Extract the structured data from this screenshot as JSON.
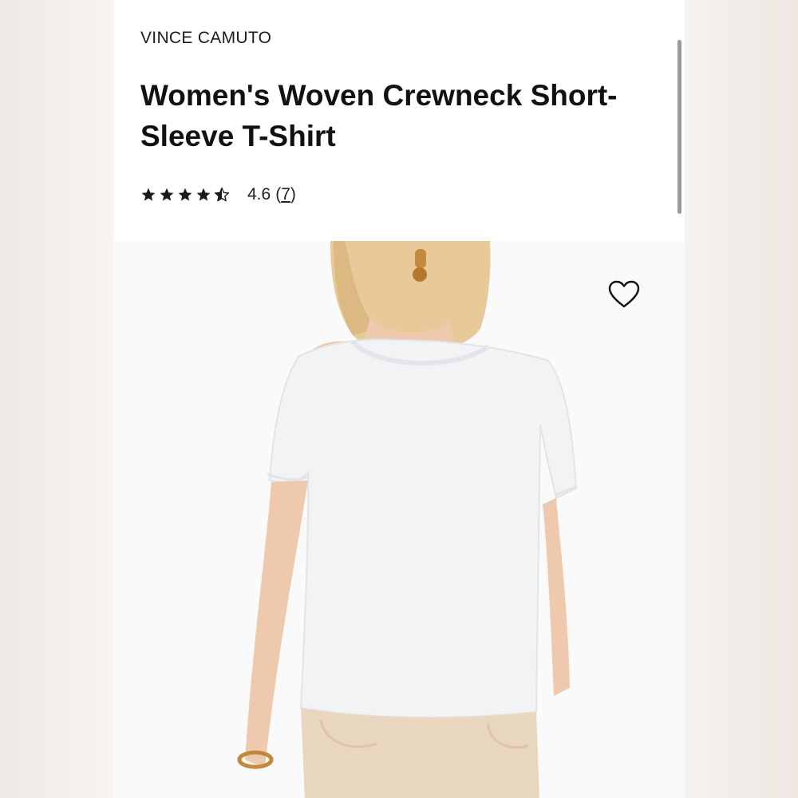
{
  "product": {
    "brand": "VINCE CAMUTO",
    "title": "Women's Woven Crewneck Short-Sleeve T-Shirt",
    "rating": {
      "stars": 4.6,
      "value_text": "4.6",
      "count_open": "(",
      "count": "7",
      "count_close": ")"
    }
  },
  "image": {
    "wishlist_icon": "heart-outline-icon",
    "background": "#fafafa"
  },
  "colors": {
    "text": "#111111",
    "star": "#1a1a1a"
  }
}
